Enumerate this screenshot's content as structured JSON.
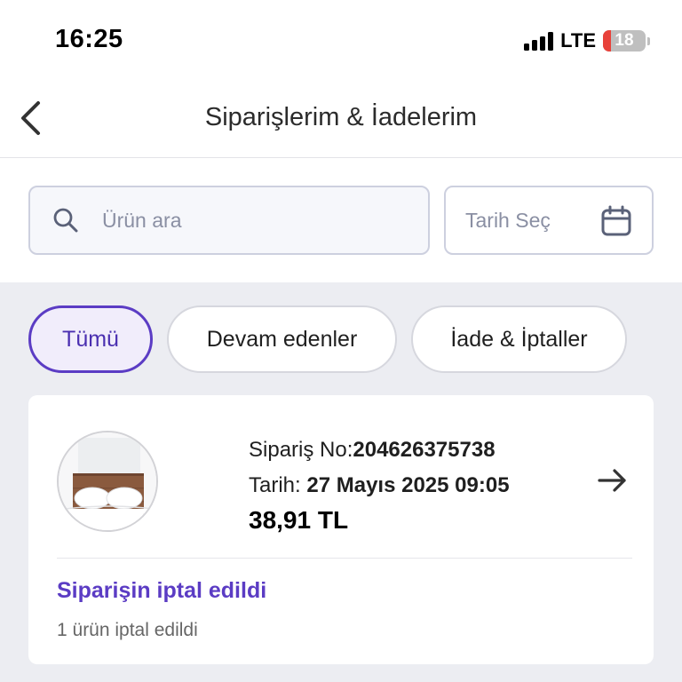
{
  "status_bar": {
    "time": "16:25",
    "network": "LTE",
    "battery": "18"
  },
  "header": {
    "back_icon": "chevron-left-icon",
    "title": "Siparişlerim & İadelerim"
  },
  "search": {
    "placeholder": "Ürün ara",
    "icon": "search-icon"
  },
  "date_filter": {
    "placeholder": "Tarih Seç",
    "icon": "calendar-icon"
  },
  "tabs": [
    {
      "label": "Tümü",
      "active": true
    },
    {
      "label": "Devam edenler",
      "active": false
    },
    {
      "label": "İade & İptaller",
      "active": false
    }
  ],
  "order": {
    "order_no_label": "Sipariş No:",
    "order_no": "204626375738",
    "date_label": "Tarih:",
    "date": "27 Mayıs 2025 09:05",
    "price": "38,91 TL",
    "status_title": "Siparişin iptal edildi",
    "status_detail": "1 ürün iptal edildi"
  },
  "colors": {
    "accent": "#5b3cc4",
    "background_grey": "#ecedf2",
    "battery_low": "#e8413a"
  }
}
